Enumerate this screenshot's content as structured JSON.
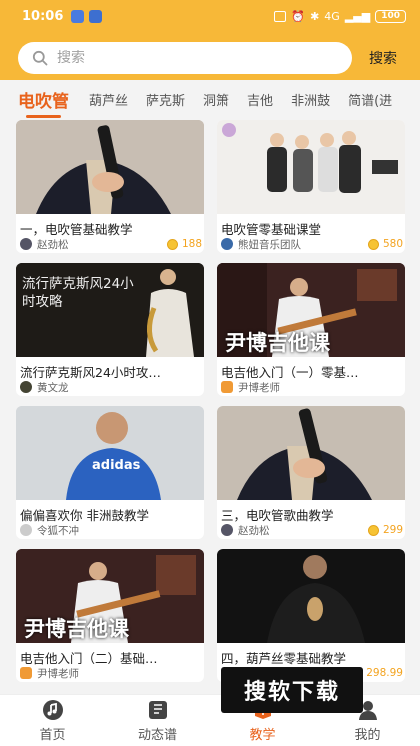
{
  "status_bar": {
    "time": "10:06",
    "network": "4G",
    "battery": "100"
  },
  "search": {
    "placeholder": "搜索",
    "button_label": "搜索"
  },
  "tabs": [
    {
      "label": "电吹管",
      "active": true
    },
    {
      "label": "葫芦丝",
      "active": false
    },
    {
      "label": "萨克斯",
      "active": false
    },
    {
      "label": "洞箫",
      "active": false
    },
    {
      "label": "吉他",
      "active": false
    },
    {
      "label": "非洲鼓",
      "active": false
    },
    {
      "label": "简谱(进",
      "active": false
    }
  ],
  "cards": [
    {
      "title": "一，电吹管基础教学",
      "author": "赵劲松",
      "price": "188"
    },
    {
      "title": "电吹管零基础课堂",
      "author": "熊妞音乐团队",
      "price": "580"
    },
    {
      "title": "流行萨克斯风24小时攻…",
      "author": "黄文龙",
      "price": "",
      "thumb_text": "流行萨克斯风24小时攻略"
    },
    {
      "title": "电吉他入门（一）零基…",
      "author": "尹博老师",
      "price": "",
      "thumb_text": "尹博吉他课"
    },
    {
      "title": "偏偏喜欢你 非洲鼓教学",
      "author": "令狐不冲",
      "price": "",
      "thumb_text": "adidas"
    },
    {
      "title": "三，电吹管歌曲教学",
      "author": "赵劲松",
      "price": "299"
    },
    {
      "title": "电吉他入门（二）基础…",
      "author": "尹博老师",
      "price": "",
      "thumb_text": "尹博吉他课"
    },
    {
      "title": "四，葫芦丝零基础教学",
      "author": "",
      "price": "298.99"
    }
  ],
  "watermark": "搜软下载",
  "bottom_nav": [
    {
      "label": "首页",
      "icon": "music-note-icon",
      "active": false
    },
    {
      "label": "动态谱",
      "icon": "sheet-music-icon",
      "active": false
    },
    {
      "label": "教学",
      "icon": "teach-icon",
      "active": true
    },
    {
      "label": "我的",
      "icon": "user-icon",
      "active": false
    }
  ],
  "colors": {
    "header": "#f7b838",
    "accent": "#e8631d",
    "price": "#f3a421"
  }
}
